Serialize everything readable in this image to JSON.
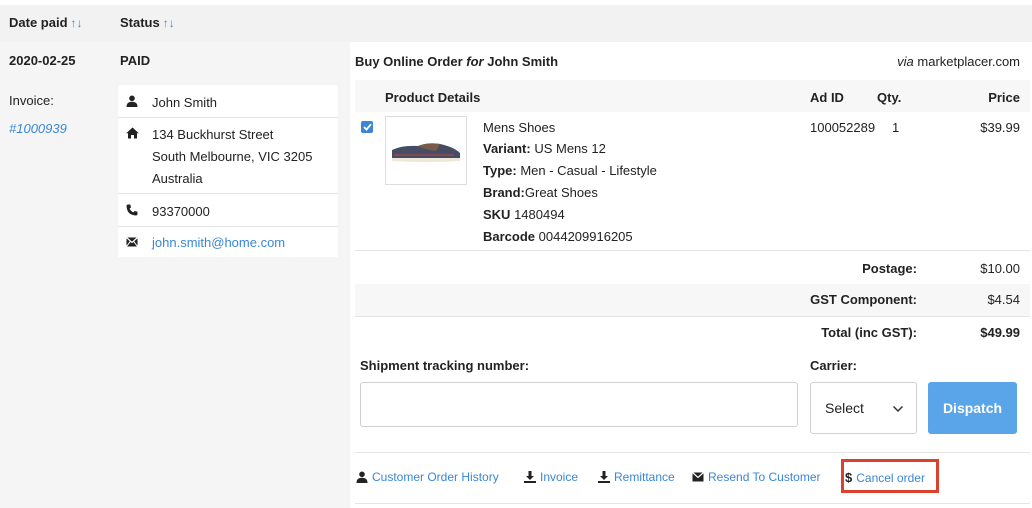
{
  "table": {
    "header": {
      "date_paid": "Date paid",
      "status": "Status",
      "sort_arrows": "↑↓"
    },
    "row": {
      "date": "2020-02-25",
      "status": "PAID",
      "invoice_label": "Invoice:",
      "invoice_link": "#1000939"
    }
  },
  "customer": {
    "name": "John Smith",
    "address_line1": "134 Buckhurst Street",
    "address_line2": "South Melbourne, VIC 3205",
    "address_line3": "Australia",
    "phone": "93370000",
    "email": "john.smith@home.com"
  },
  "order": {
    "title_prefix": "Buy Online Order",
    "title_for": "for",
    "title_name": "John Smith",
    "via_italic": "via",
    "via_site": "marketplacer.com",
    "columns": {
      "product": "Product Details",
      "ad_id": "Ad ID",
      "qty": "Qty.",
      "price": "Price"
    },
    "item": {
      "checked": true,
      "name": "Mens Shoes",
      "variant_label": "Variant:",
      "variant_value": "US Mens 12",
      "type_label": "Type:",
      "type_value": "Men - Casual - Lifestyle",
      "brand_label": "Brand:",
      "brand_value": "Great Shoes",
      "sku_label": "SKU",
      "sku_value": "1480494",
      "barcode_label": "Barcode",
      "barcode_value": "0044209916205",
      "ad_id": "100052289",
      "qty": "1",
      "price": "$39.99"
    },
    "totals": {
      "postage_label": "Postage:",
      "postage_value": "$10.00",
      "gst_label": "GST Component:",
      "gst_value": "$4.54",
      "total_label": "Total (inc GST):",
      "total_value": "$49.99"
    },
    "shipment": {
      "tracking_label": "Shipment tracking number:",
      "tracking_value": "",
      "carrier_label": "Carrier:",
      "carrier_selected": "Select",
      "dispatch": "Dispatch"
    },
    "actions": {
      "history": "Customer Order History",
      "invoice": "Invoice",
      "remittance": "Remittance",
      "resend": "Resend To Customer",
      "cancel": "Cancel order"
    }
  },
  "colors": {
    "link": "#3a87d6",
    "dispatch": "#5aa4ea",
    "highlight": "#d9422c",
    "header_bg": "#f2f2f2"
  }
}
